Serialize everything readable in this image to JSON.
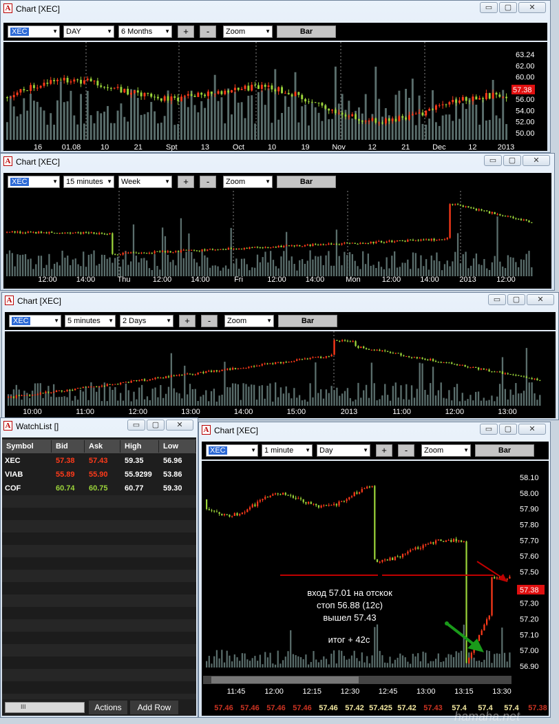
{
  "colors": {
    "up": "#9bd43a",
    "down": "#ff3a1a",
    "volume": "#5a6e6c",
    "axis": "#ffffff",
    "price_badge": "#e01010",
    "level_line": "#c00000",
    "arrow_red": "#c00000",
    "arrow_green": "#1a9a1a"
  },
  "chart1": {
    "title": "Chart [XEC]",
    "symbol": "XEC",
    "interval": "DAY",
    "range": "6 Months",
    "zoom": "Zoom",
    "bar_label": "Bar",
    "x_ticks": [
      "16",
      "01.08",
      "10",
      "21",
      "Spt",
      "13",
      "Oct",
      "10",
      "19",
      "Nov",
      "12",
      "21",
      "Dec",
      "12",
      "2013"
    ],
    "y_ticks": [
      "63.24",
      "62.00",
      "60.00",
      "58.00",
      "56.00",
      "54.00",
      "52.00",
      "50.00"
    ],
    "price_tag": "57.38"
  },
  "chart2": {
    "title": "Chart [XEC]",
    "symbol": "XEC",
    "interval": "15 minutes",
    "range": "Week",
    "zoom": "Zoom",
    "bar_label": "Bar",
    "x_ticks": [
      "12:00",
      "14:00",
      "Thu",
      "12:00",
      "14:00",
      "Fri",
      "12:00",
      "14:00",
      "Mon",
      "12:00",
      "14:00",
      "2013",
      "12:00"
    ]
  },
  "chart3": {
    "title": "Chart [XEC]",
    "symbol": "XEC",
    "interval": "5 minutes",
    "range": "2 Days",
    "zoom": "Zoom",
    "bar_label": "Bar",
    "x_ticks": [
      "10:00",
      "11:00",
      "12:00",
      "13:00",
      "14:00",
      "15:00",
      "2013",
      "11:00",
      "12:00",
      "13:00"
    ]
  },
  "chart4": {
    "title": "Chart [XEC]",
    "symbol": "XEC",
    "interval": "1 minute",
    "range": "Day",
    "zoom": "Zoom",
    "bar_label": "Bar",
    "x_ticks": [
      "11:45",
      "12:00",
      "12:15",
      "12:30",
      "12:45",
      "13:00",
      "13:15",
      "13:30"
    ],
    "y_ticks": [
      "58.10",
      "58.00",
      "57.90",
      "57.80",
      "57.70",
      "57.60",
      "57.50",
      "57.40",
      "57.30",
      "57.20",
      "57.10",
      "57.00",
      "56.90"
    ],
    "price_tag": "57.38",
    "notes": [
      "вход 57.01 на отскок",
      "стоп 56.88 (12c)",
      "вышел 57.43",
      "итог + 42c"
    ],
    "bottom_prices": [
      {
        "v": "57.46",
        "c": "down"
      },
      {
        "v": "57.46",
        "c": "down"
      },
      {
        "v": "57.46",
        "c": "down"
      },
      {
        "v": "57.46",
        "c": "down"
      },
      {
        "v": "57.46",
        "c": "up"
      },
      {
        "v": "57.42",
        "c": "up"
      },
      {
        "v": "57.425",
        "c": "up"
      },
      {
        "v": "57.42",
        "c": "up"
      },
      {
        "v": "57.43",
        "c": "down"
      },
      {
        "v": "57.4",
        "c": "up"
      },
      {
        "v": "57.4",
        "c": "up"
      },
      {
        "v": "57.4",
        "c": "up"
      },
      {
        "v": "57.38",
        "c": "down"
      }
    ]
  },
  "watchlist": {
    "title": "WatchList []",
    "headers": [
      "Symbol",
      "Bid",
      "Ask",
      "High",
      "Low"
    ],
    "rows": [
      {
        "symbol": "XEC",
        "bid": "57.38",
        "ask": "57.43",
        "high": "59.35",
        "low": "56.96",
        "bid_c": "down",
        "ask_c": "down"
      },
      {
        "symbol": "VIAB",
        "bid": "55.89",
        "ask": "55.90",
        "high": "55.9299",
        "low": "53.86",
        "bid_c": "down",
        "ask_c": "down"
      },
      {
        "symbol": "COF",
        "bid": "60.74",
        "ask": "60.75",
        "high": "60.77",
        "low": "59.30",
        "bid_c": "up",
        "ask_c": "up"
      }
    ],
    "actions_label": "Actions",
    "add_row_label": "Add Row",
    "scroll_glyph": "III"
  },
  "watermark": "hamaha.net",
  "window_buttons": {
    "min": "▭",
    "max": "▢",
    "close": "✕"
  }
}
